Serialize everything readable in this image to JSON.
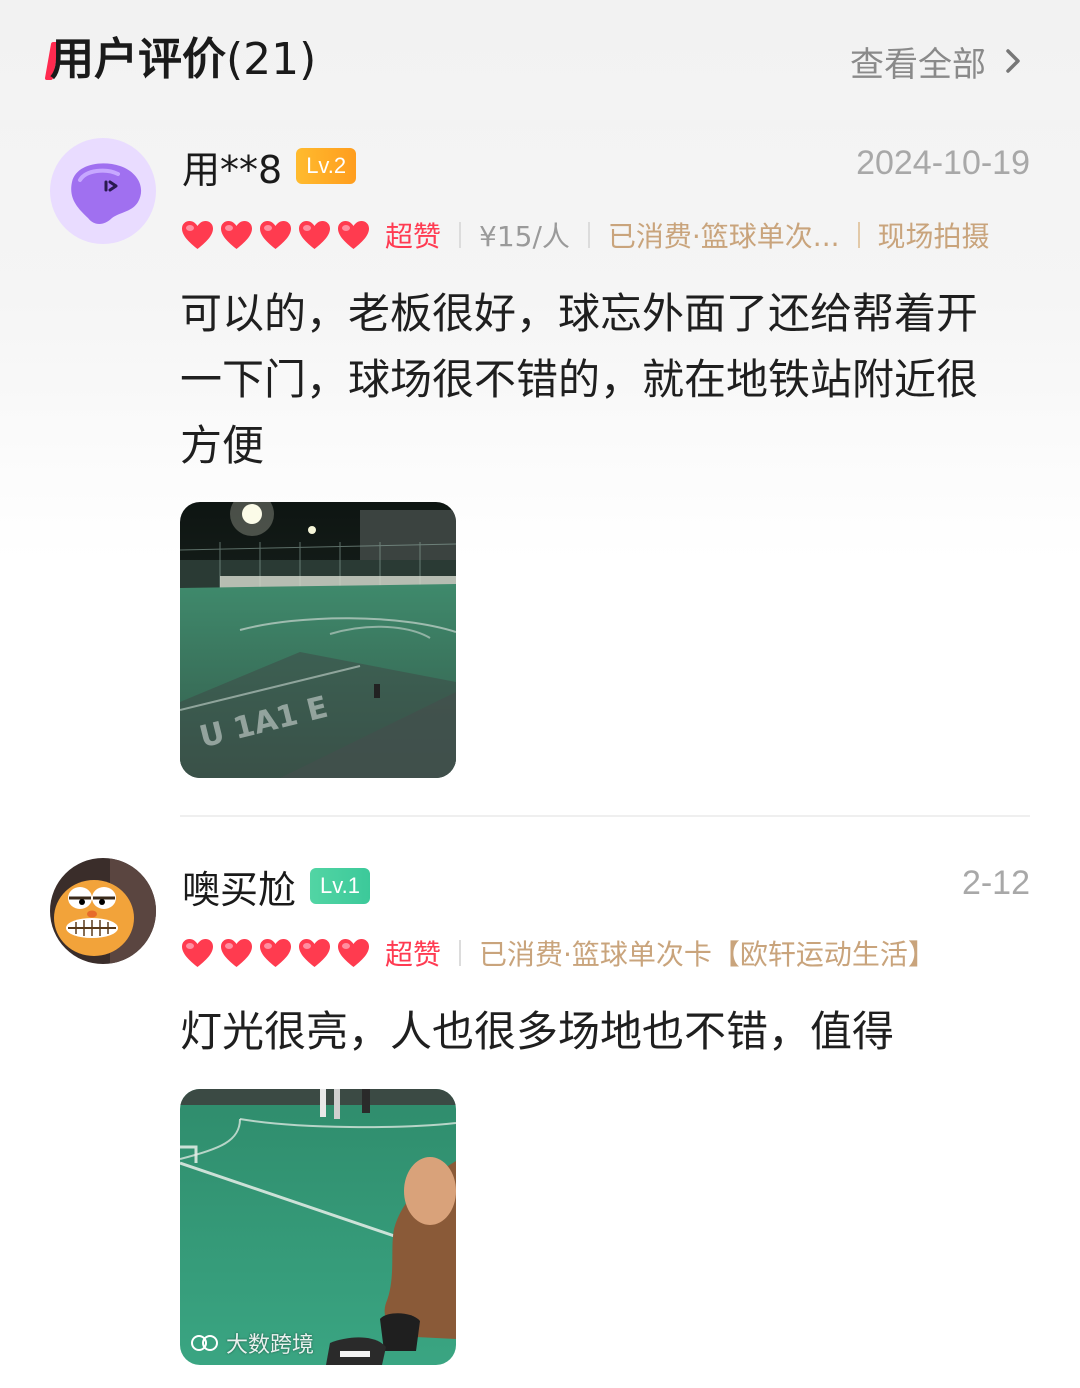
{
  "header": {
    "title": "用户评价",
    "count": "(21)",
    "view_all": "查看全部",
    "accent_color": "#ff2a4f"
  },
  "reviews": [
    {
      "user_name": "用**8",
      "level": "Lv.2",
      "date": "2024-10-19",
      "rating_hearts": 5,
      "rating_text": "超赞",
      "price": "¥15/人",
      "consumed": "已消费·篮球单次...",
      "tag": "现场拍摄",
      "text": "可以的，老板很好，球忘外面了还给帮着开一下门，球场很不错的，就在地铁站附近很方便",
      "avatar_icon": "purple-blob-avatar",
      "photo_icon": "night-basketball-court-photo"
    },
    {
      "user_name": "噢买尬",
      "level": "Lv.1",
      "date": "2-12",
      "rating_hearts": 5,
      "rating_text": "超赞",
      "consumed": "已消费·篮球单次卡【欧轩运动生活】",
      "text": "灯光很亮，人也很多场地也不错，值得",
      "avatar_icon": "garfield-avatar",
      "photo_icon": "green-court-photo"
    }
  ],
  "watermark": "大数跨境",
  "colors": {
    "rating_red": "#ff3b52",
    "meta_gold": "#c9a47c",
    "lv2_badge": "#ffaa26",
    "lv1_badge": "#48cf9e"
  }
}
